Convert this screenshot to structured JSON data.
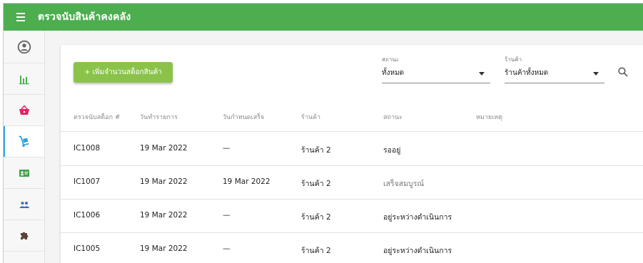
{
  "app": {
    "title": "ตรวจนับสินค้าคงคลัง"
  },
  "colors": {
    "topbar": "#4cae4f",
    "primary_button": "#8bc34a",
    "active_indicator": "#3aa0d8"
  },
  "sidebar": {
    "items": [
      {
        "icon": "account-circle-icon",
        "color": "#666666"
      },
      {
        "icon": "bar-chart-icon",
        "color": "#4caf50"
      },
      {
        "icon": "shopping-basket-icon",
        "color": "#e91e63"
      },
      {
        "icon": "hand-truck-icon",
        "color": "#29a3d9",
        "active": true
      },
      {
        "icon": "id-card-icon",
        "color": "#43a047"
      },
      {
        "icon": "people-icon",
        "color": "#3f6fb5"
      },
      {
        "icon": "puzzle-icon",
        "color": "#5d4037"
      }
    ]
  },
  "toolbar": {
    "add_button": "+ เพิ่มจำนวนสต็อกสินค้า",
    "status_filter": {
      "label": "สถานะ",
      "value": "ทั้งหมด"
    },
    "store_filter": {
      "label": "ร้านค้า",
      "value": "ร้านค้าทั้งหมด"
    },
    "search_icon": "search-icon"
  },
  "table": {
    "headers": [
      "ตรวจนับสต็อก #",
      "วันทำรายการ",
      "วันกำหนดเสร็จ",
      "ร้านค้า",
      "สถานะ",
      "หมายเหตุ"
    ],
    "rows": [
      {
        "id": "IC1008",
        "date": "19 Mar 2022",
        "due": "—",
        "store": "ร้านค้า 2",
        "status": "รออยู่",
        "note": ""
      },
      {
        "id": "IC1007",
        "date": "19 Mar 2022",
        "due": "19 Mar 2022",
        "store": "ร้านค้า 2",
        "status": "เสร็จสมบูรณ์",
        "note": ""
      },
      {
        "id": "IC1006",
        "date": "19 Mar 2022",
        "due": "—",
        "store": "ร้านค้า 2",
        "status": "อยู่ระหว่างดำเนินการ",
        "note": ""
      },
      {
        "id": "IC1005",
        "date": "19 Mar 2022",
        "due": "—",
        "store": "ร้านค้า 2",
        "status": "อยู่ระหว่างดำเนินการ",
        "note": ""
      }
    ]
  }
}
